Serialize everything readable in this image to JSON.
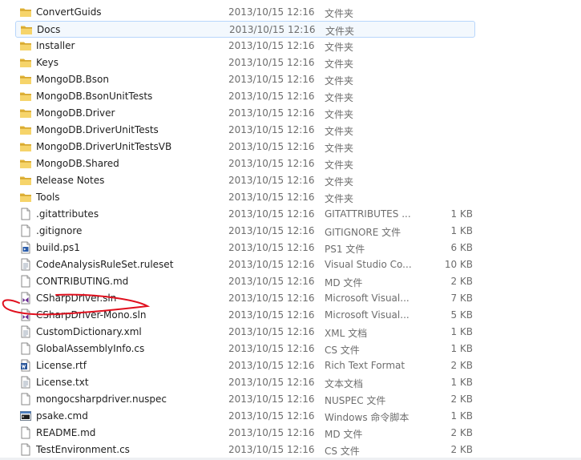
{
  "files": [
    {
      "name": "ConvertGuids",
      "date": "2013/10/15 12:16",
      "type": "文件夹",
      "size": "",
      "icon": "folder-icon"
    },
    {
      "name": "Docs",
      "date": "2013/10/15 12:16",
      "type": "文件夹",
      "size": "",
      "icon": "folder-icon",
      "selected": true
    },
    {
      "name": "Installer",
      "date": "2013/10/15 12:16",
      "type": "文件夹",
      "size": "",
      "icon": "folder-icon"
    },
    {
      "name": "Keys",
      "date": "2013/10/15 12:16",
      "type": "文件夹",
      "size": "",
      "icon": "folder-icon"
    },
    {
      "name": "MongoDB.Bson",
      "date": "2013/10/15 12:16",
      "type": "文件夹",
      "size": "",
      "icon": "folder-icon"
    },
    {
      "name": "MongoDB.BsonUnitTests",
      "date": "2013/10/15 12:16",
      "type": "文件夹",
      "size": "",
      "icon": "folder-icon"
    },
    {
      "name": "MongoDB.Driver",
      "date": "2013/10/15 12:16",
      "type": "文件夹",
      "size": "",
      "icon": "folder-icon"
    },
    {
      "name": "MongoDB.DriverUnitTests",
      "date": "2013/10/15 12:16",
      "type": "文件夹",
      "size": "",
      "icon": "folder-icon"
    },
    {
      "name": "MongoDB.DriverUnitTestsVB",
      "date": "2013/10/15 12:16",
      "type": "文件夹",
      "size": "",
      "icon": "folder-icon"
    },
    {
      "name": "MongoDB.Shared",
      "date": "2013/10/15 12:16",
      "type": "文件夹",
      "size": "",
      "icon": "folder-icon"
    },
    {
      "name": "Release Notes",
      "date": "2013/10/15 12:16",
      "type": "文件夹",
      "size": "",
      "icon": "folder-icon"
    },
    {
      "name": "Tools",
      "date": "2013/10/15 12:16",
      "type": "文件夹",
      "size": "",
      "icon": "folder-icon"
    },
    {
      "name": ".gitattributes",
      "date": "2013/10/15 12:16",
      "type": "GITATTRIBUTES ...",
      "size": "1 KB",
      "icon": "file-icon"
    },
    {
      "name": ".gitignore",
      "date": "2013/10/15 12:16",
      "type": "GITIGNORE 文件",
      "size": "1 KB",
      "icon": "file-icon"
    },
    {
      "name": "build.ps1",
      "date": "2013/10/15 12:16",
      "type": "PS1 文件",
      "size": "6 KB",
      "icon": "script-file-icon"
    },
    {
      "name": "CodeAnalysisRuleSet.ruleset",
      "date": "2013/10/15 12:16",
      "type": "Visual Studio Co...",
      "size": "10 KB",
      "icon": "text-file-icon"
    },
    {
      "name": "CONTRIBUTING.md",
      "date": "2013/10/15 12:16",
      "type": "MD 文件",
      "size": "2 KB",
      "icon": "file-icon"
    },
    {
      "name": "CSharpDriver.sln",
      "date": "2013/10/15 12:16",
      "type": "Microsoft Visual...",
      "size": "7 KB",
      "icon": "visual-studio-solution-icon"
    },
    {
      "name": "CSharpDriver-Mono.sln",
      "date": "2013/10/15 12:16",
      "type": "Microsoft Visual...",
      "size": "5 KB",
      "icon": "visual-studio-solution-icon"
    },
    {
      "name": "CustomDictionary.xml",
      "date": "2013/10/15 12:16",
      "type": "XML 文档",
      "size": "1 KB",
      "icon": "text-file-icon"
    },
    {
      "name": "GlobalAssemblyInfo.cs",
      "date": "2013/10/15 12:16",
      "type": "CS 文件",
      "size": "1 KB",
      "icon": "file-icon"
    },
    {
      "name": "License.rtf",
      "date": "2013/10/15 12:16",
      "type": "Rich Text Format",
      "size": "2 KB",
      "icon": "word-document-icon"
    },
    {
      "name": "License.txt",
      "date": "2013/10/15 12:16",
      "type": "文本文档",
      "size": "1 KB",
      "icon": "text-file-icon"
    },
    {
      "name": "mongocsharpdriver.nuspec",
      "date": "2013/10/15 12:16",
      "type": "NUSPEC 文件",
      "size": "2 KB",
      "icon": "file-icon"
    },
    {
      "name": "psake.cmd",
      "date": "2013/10/15 12:16",
      "type": "Windows 命令脚本",
      "size": "1 KB",
      "icon": "command-script-icon"
    },
    {
      "name": "README.md",
      "date": "2013/10/15 12:16",
      "type": "MD 文件",
      "size": "2 KB",
      "icon": "file-icon"
    },
    {
      "name": "TestEnvironment.cs",
      "date": "2013/10/15 12:16",
      "type": "CS 文件",
      "size": "2 KB",
      "icon": "file-icon"
    }
  ],
  "colors": {
    "selection_bg": "#f3f8fd",
    "selection_border": "#b8d6fb",
    "annotation_red": "#e0101e",
    "folder_yellow": "#f0c84a"
  }
}
